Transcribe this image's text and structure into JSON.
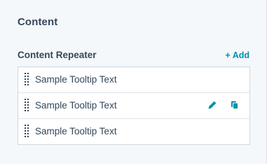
{
  "section": {
    "title": "Content"
  },
  "repeater": {
    "label": "Content Repeater",
    "add_plus": "+",
    "add_label": "Add",
    "items": [
      {
        "label": "Sample Tooltip Text"
      },
      {
        "label": "Sample Tooltip Text"
      },
      {
        "label": "Sample Tooltip Text"
      }
    ]
  },
  "icons": {
    "drag": "drag-handle-icon",
    "edit": "pencil-icon",
    "clone": "clone-icon"
  },
  "colors": {
    "panel_bg": "#f5f8fa",
    "text": "#33475b",
    "accent": "#0091ae",
    "border": "#cbd6e2"
  }
}
